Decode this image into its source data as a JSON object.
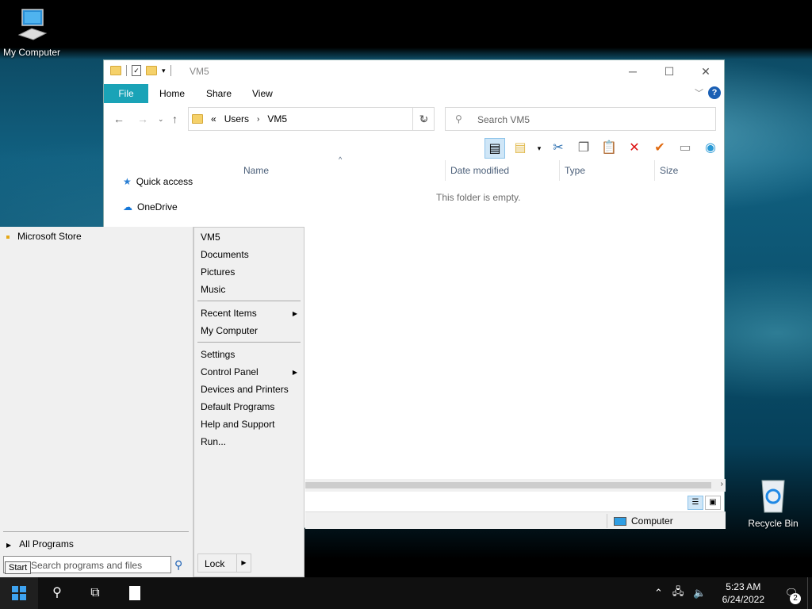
{
  "desktop": {
    "icons": [
      {
        "label": "My Computer"
      },
      {
        "label": "Recycle Bin"
      }
    ]
  },
  "explorer": {
    "title": "VM5",
    "tabs": [
      {
        "label": "File"
      },
      {
        "label": "Home"
      },
      {
        "label": "Share"
      },
      {
        "label": "View"
      }
    ],
    "breadcrumbs": [
      "«",
      "Users",
      "VM5"
    ],
    "search_placeholder": "Search VM5",
    "nav_items": [
      {
        "label": "Quick access",
        "icon": "star-icon"
      },
      {
        "label": "OneDrive",
        "icon": "cloud-icon"
      }
    ],
    "columns": [
      "Name",
      "Date modified",
      "Type",
      "Size"
    ],
    "empty_message": "This folder is empty.",
    "status_location": "Computer"
  },
  "start_menu": {
    "left_items": [
      {
        "label": "Microsoft Store"
      }
    ],
    "all_programs": "All Programs",
    "search_placeholder": "Search programs and files",
    "right_items": [
      {
        "label": "VM5"
      },
      {
        "label": "Documents"
      },
      {
        "label": "Pictures"
      },
      {
        "label": "Music"
      },
      {
        "label": "Recent Items",
        "submenu": true
      },
      {
        "label": "My Computer"
      },
      {
        "label": "Settings"
      },
      {
        "label": "Control Panel",
        "submenu": true
      },
      {
        "label": "Devices and Printers"
      },
      {
        "label": "Default Programs"
      },
      {
        "label": "Help and Support"
      },
      {
        "label": "Run..."
      }
    ],
    "lock_label": "Lock",
    "tooltip": "Start"
  },
  "taskbar": {
    "time": "5:23 AM",
    "date": "6/24/2022",
    "notification_count": "2"
  }
}
